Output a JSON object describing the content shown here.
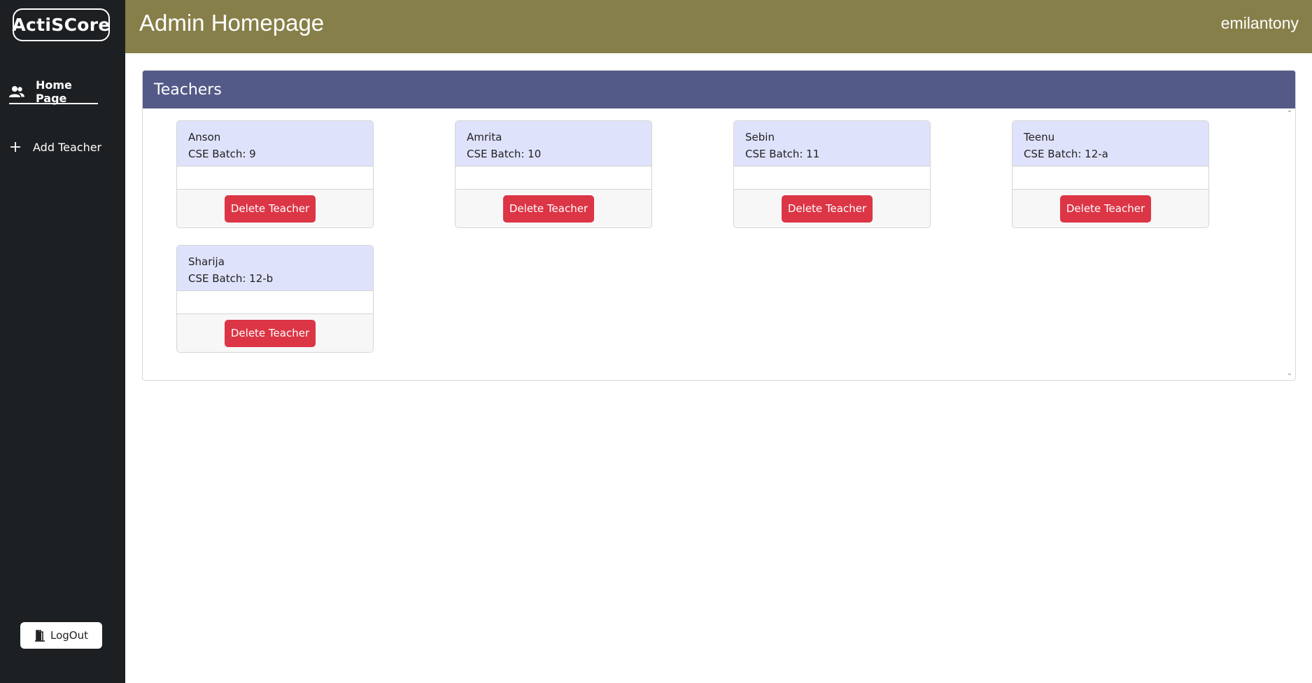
{
  "app": {
    "logo": "ActiSCore"
  },
  "sidebar": {
    "items": [
      {
        "label": "Home Page",
        "icon": "users-icon",
        "active": true
      },
      {
        "label": "Add Teacher",
        "icon": "plus-icon",
        "active": false
      }
    ],
    "logout_label": "LogOut"
  },
  "header": {
    "title": "Admin Homepage",
    "username": "emilantony"
  },
  "panel": {
    "title": "Teachers",
    "teachers": [
      {
        "name": "Anson",
        "batch": "CSE Batch: 9"
      },
      {
        "name": "Amrita",
        "batch": "CSE Batch: 10"
      },
      {
        "name": "Sebin",
        "batch": "CSE Batch: 11"
      },
      {
        "name": "Teenu",
        "batch": "CSE Batch: 12-a"
      },
      {
        "name": "Sharija",
        "batch": "CSE Batch: 12-b"
      }
    ],
    "delete_label": "Delete Teacher"
  },
  "colors": {
    "sidebar": "#1d2023",
    "topbar": "#877f49",
    "panel_header": "#535a88",
    "card_header": "#dfe2fb",
    "danger": "#dc3545"
  }
}
